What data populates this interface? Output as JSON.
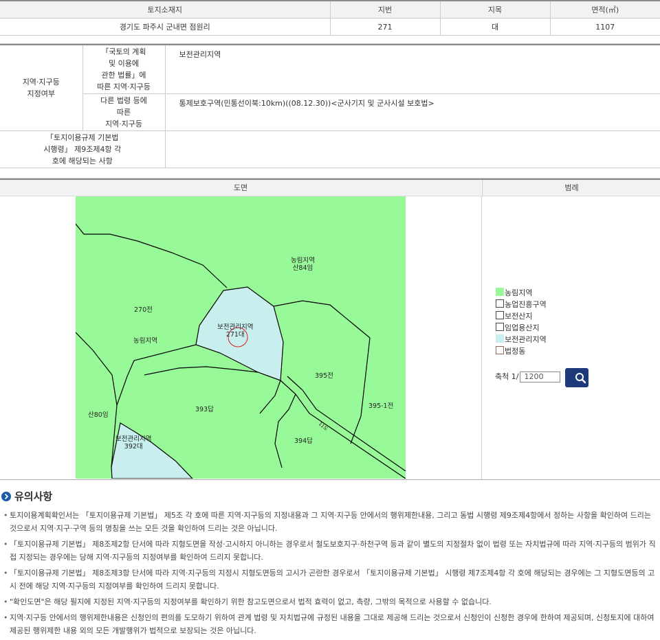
{
  "land_table": {
    "headers": [
      "토지소재지",
      "지번",
      "지목",
      "면적(㎡)"
    ],
    "row": [
      "경기도 파주시 군내면 점원리",
      "271",
      "대",
      "1107"
    ]
  },
  "zoning": {
    "main_label": "지역·지구등\n지정여부",
    "rows": [
      {
        "label": "「국토의 계획\n및 이용에\n관한 법률」에\n따른 지역·지구등",
        "value": "보전관리지역"
      },
      {
        "label": "다른 법령 등에\n따른\n지역·지구등",
        "value": "통제보호구역(민통선이북:10km)((08.12.30))<군사기지 및 군사시설 보호법>"
      }
    ],
    "enforcement_label": "「토지이용규제 기본법\n시행령」 제9조제4항 각\n호에 해당되는 사항",
    "enforcement_value": ""
  },
  "map_section": {
    "map_header": "도면",
    "legend_header": "범례",
    "labels": [
      {
        "id": "farm-forest-1",
        "text": "농림지역\n산84임"
      },
      {
        "id": "parcel-270",
        "text": "270전"
      },
      {
        "id": "farm-forest-2",
        "text": "농림지역"
      },
      {
        "id": "parcel-271",
        "text": "보전관리지역\n271대"
      },
      {
        "id": "parcel-395",
        "text": "395전"
      },
      {
        "id": "parcel-395-1",
        "text": "395-1전"
      },
      {
        "id": "parcel-393",
        "text": "393답"
      },
      {
        "id": "parcel-80",
        "text": "산80임"
      },
      {
        "id": "parcel-392",
        "text": "보전관리지역\n392대"
      },
      {
        "id": "parcel-394",
        "text": "394답"
      },
      {
        "id": "road",
        "text": "11도"
      }
    ],
    "legend": [
      {
        "label": "농림지역",
        "color": "#98f998"
      },
      {
        "label": "농업진흥구역",
        "color": "#ffffff"
      },
      {
        "label": "보전산지",
        "color": "#ffffff"
      },
      {
        "label": "임업용산지",
        "color": "#ffffff"
      },
      {
        "label": "보전관리지역",
        "color": "#c8eeee"
      },
      {
        "label": "법정동",
        "color": "#ffffff"
      }
    ],
    "scale_label": "축척 1/",
    "scale_value": "1200",
    "search_icon": "search-icon"
  },
  "notes": {
    "title": "유의사항",
    "items": [
      "토지이용계획확인서는 「토지이용규제 기본법」 제5조 각 호에 따른 지역·지구등의 지정내용과 그 지역·지구등 안에서의 행위제한내용, 그리고 동법 시행령 제9조제4항에서 정하는 사항을 확인하여 드리는 것으로서 지역·지구·구역 등의 명칭을 쓰는 모든 것을 확인하여 드리는 것은 아닙니다.",
      "「토지이용규제 기본법」 제8조제2항 단서에 따라 지형도면을 작성·고시하지 아니하는 경우로서 철도보호지구·하천구역 등과 같이 별도의 지정절차 없이 법령 또는 자치법규에 따라 지역·지구등의 범위가 직접 지정되는 경우에는 당해 지역·지구등의 지정여부를 확인하여 드리지 못합니다.",
      "「토지이용규제 기본법」 제8조제3항 단서에 따라 지역·지구등의 지정시 지형도면등의 고시가 곤란한 경우로서 「토지이용규제 기본법」 시행령 제7조제4항 각 호에 해당되는 경우에는 그 지형도면등의 고시 전에 해당 지역·지구등의 지정여부를 확인하여 드리지 못합니다.",
      "\"확인도면\"은 해당 필지에 지정된 지역·지구등의 지정여부를 확인하기 위한 참고도면으로서 법적 효력이 없고, 측량, 그밖의 목적으로 사용할 수 없습니다.",
      "지역·지구등 안에서의 행위제한내용은 신청인의 편의를 도모하기 위하여 관계 법령 및 자치법규에 규정된 내용을 그대로 제공해 드리는 것으로서 신청인이 신청한 경우에 한하여 제공되며, 신청토지에 대하여 제공된 행위제한 내용 외의 모든 개발행위가 법적으로 보장되는 것은 아닙니다."
    ]
  }
}
